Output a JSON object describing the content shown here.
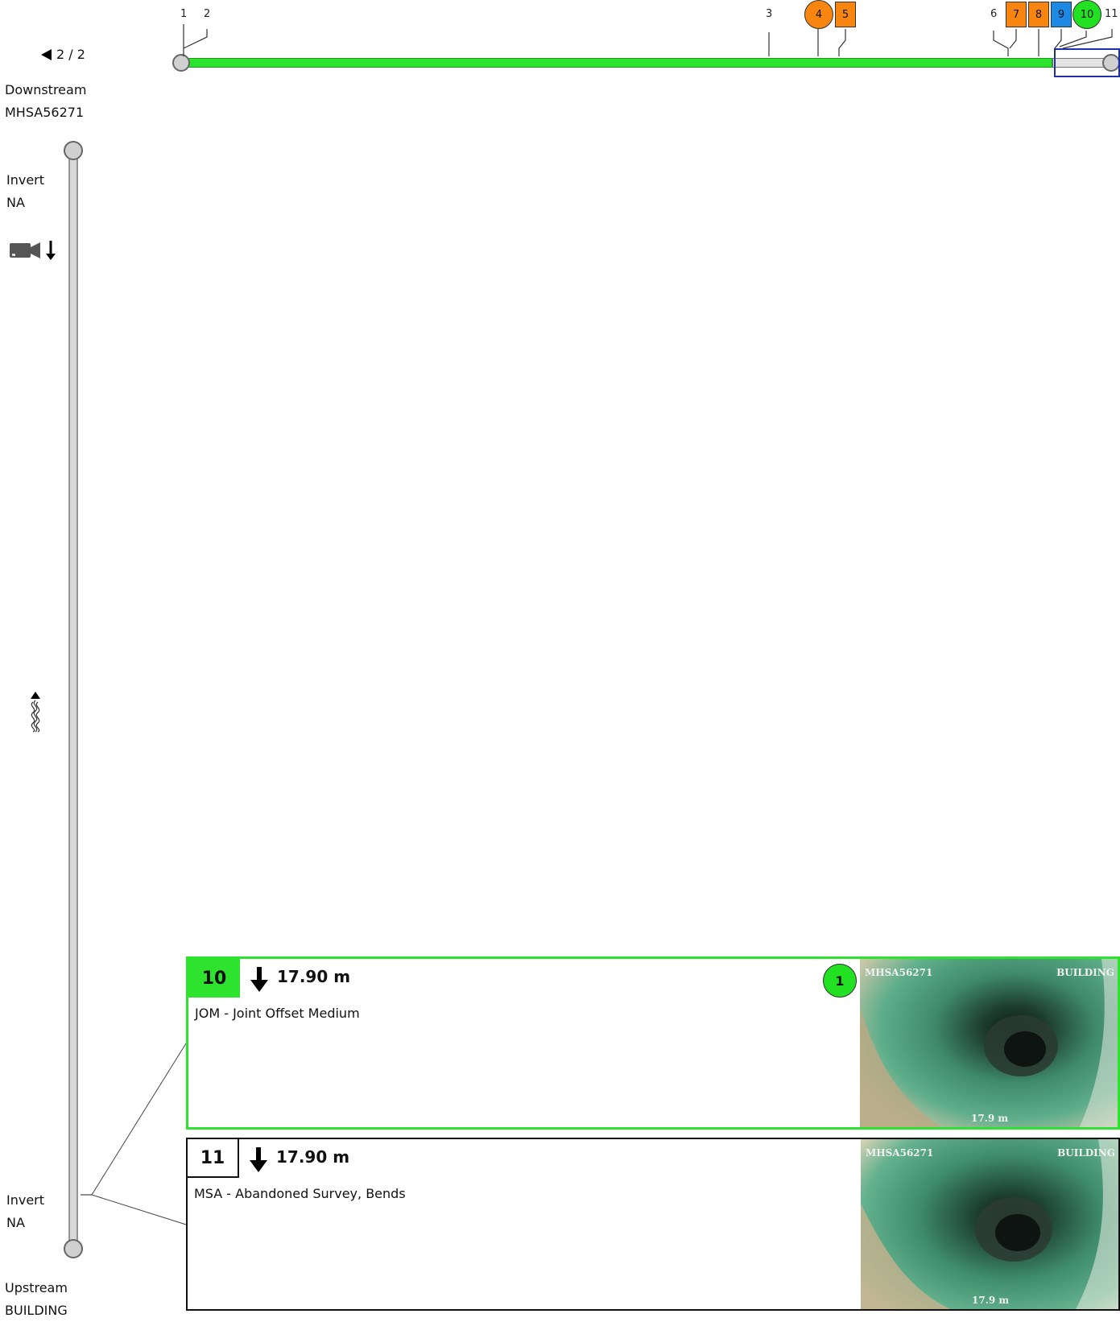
{
  "nav": {
    "page_label": "2 / 2"
  },
  "downstream": {
    "label": "Downstream",
    "id": "MHSA56271"
  },
  "upstream": {
    "label": "Upstream",
    "id": "BUILDING"
  },
  "invert_top": {
    "label": "Invert",
    "value": "NA"
  },
  "invert_bottom": {
    "label": "Invert",
    "value": "NA"
  },
  "timeline_marks": [
    {
      "n": "1"
    },
    {
      "n": "2"
    },
    {
      "n": "3"
    },
    {
      "n": "4"
    },
    {
      "n": "5"
    },
    {
      "n": "6"
    },
    {
      "n": "7"
    },
    {
      "n": "8"
    },
    {
      "n": "9"
    },
    {
      "n": "10"
    },
    {
      "n": "11"
    }
  ],
  "colors": {
    "pipe_green": "#2ee32e",
    "orange": "#f7850f",
    "blue": "#1e88e5",
    "green_marker": "#22e022",
    "selection_blue": "#1f2fb0"
  },
  "observations": [
    {
      "index": "10",
      "direction_icon": "arrow-down-icon",
      "distance": "17.90 m",
      "description": "JOM - Joint Offset Medium",
      "grade": "1",
      "photo": {
        "left_caption": "MHSA56271",
        "right_caption": "BUILDING",
        "distance_caption": "17.9 m"
      }
    },
    {
      "index": "11",
      "direction_icon": "arrow-down-icon",
      "distance": "17.90 m",
      "description": "MSA - Abandoned Survey, Bends",
      "photo": {
        "left_caption": "MHSA56271",
        "right_caption": "BUILDING",
        "distance_caption": "17.9 m"
      }
    }
  ]
}
